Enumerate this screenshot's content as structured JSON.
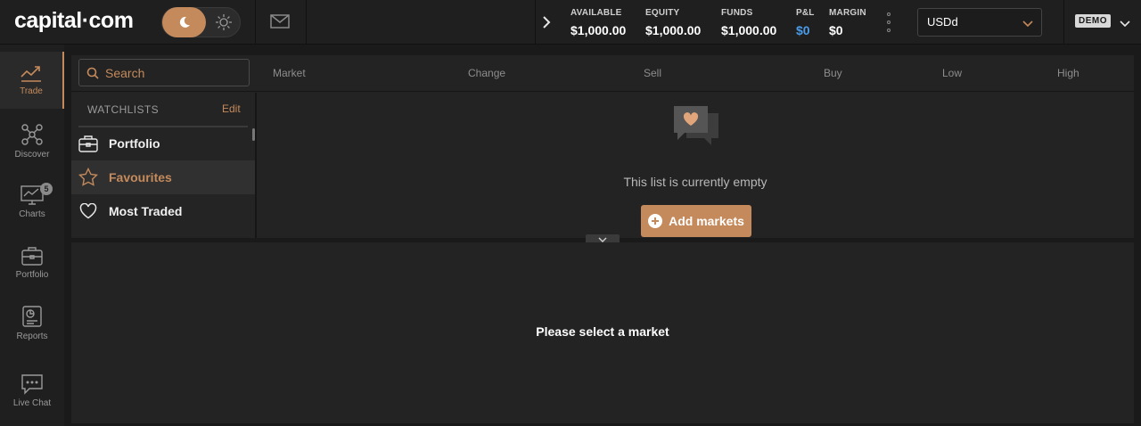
{
  "app": {
    "logo": "capital·com"
  },
  "header": {
    "theme_toggle": {
      "active": "dark",
      "dark_icon": "moon-icon",
      "light_icon": "sun-icon"
    },
    "stats": [
      {
        "label": "AVAILABLE",
        "value": "$1,000.00"
      },
      {
        "label": "EQUITY",
        "value": "$1,000.00"
      },
      {
        "label": "FUNDS",
        "value": "$1,000.00"
      },
      {
        "label": "P&L",
        "value": "$0"
      },
      {
        "label": "MARGIN",
        "value": "$0"
      }
    ],
    "currency": "USDd",
    "account_mode": "DEMO"
  },
  "sidebar": {
    "items": [
      {
        "label": "Trade",
        "icon": "trend-icon"
      },
      {
        "label": "Discover",
        "icon": "network-icon"
      },
      {
        "label": "Charts",
        "icon": "chart-monitor-icon",
        "badge": "5"
      },
      {
        "label": "Portfolio",
        "icon": "briefcase-icon"
      },
      {
        "label": "Reports",
        "icon": "report-icon"
      },
      {
        "label": "Live Chat",
        "icon": "chat-icon"
      }
    ]
  },
  "market_table": {
    "search_placeholder": "Search",
    "columns": [
      "Market",
      "Change",
      "Sell",
      "Buy",
      "Low",
      "High"
    ]
  },
  "watchlists": {
    "title": "WATCHLISTS",
    "edit_label": "Edit",
    "items": [
      {
        "label": "Portfolio",
        "icon": "briefcase-icon"
      },
      {
        "label": "Favourites",
        "icon": "star-icon"
      },
      {
        "label": "Most Traded",
        "icon": "heart-icon"
      }
    ]
  },
  "empty_state": {
    "message": "This list is currently empty",
    "add_button": "Add markets"
  },
  "detail": {
    "message": "Please select a market"
  },
  "colors": {
    "accent": "#c48a5c",
    "positive": "#4a9be8",
    "background": "#1a1a1a"
  }
}
